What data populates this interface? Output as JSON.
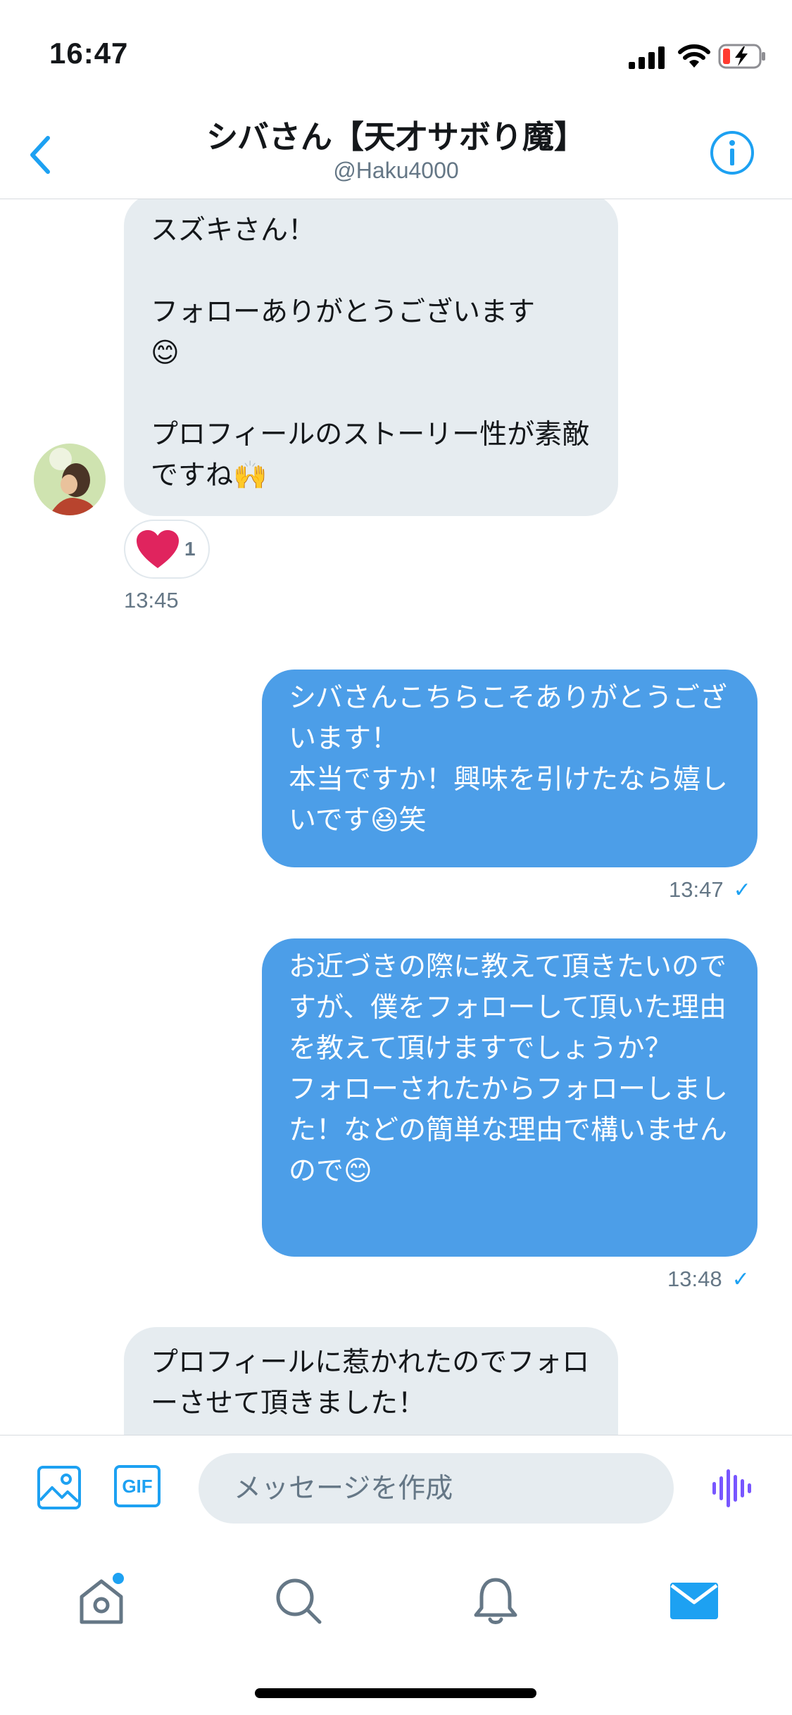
{
  "status_bar": {
    "time": "16:47"
  },
  "header": {
    "title": "シバさん【天才サボり魔】",
    "handle": "@Haku4000"
  },
  "messages": [
    {
      "direction": "incoming",
      "text": "スズキさん！\n\nフォローありがとうございます\n😊\n\nプロフィールのストーリー性が素敵ですね🙌",
      "reaction": {
        "emoji": "heart",
        "count": "1"
      },
      "time": "13:45"
    },
    {
      "direction": "outgoing",
      "text": "シバさんこちらこそありがとうございます！\n本当ですか！興味を引けたなら嬉しいです😆笑",
      "time": "13:47"
    },
    {
      "direction": "outgoing",
      "text": "お近づきの際に教えて頂きたいのですが、僕をフォローして頂いた理由を教えて頂けますでしょうか？\nフォローされたからフォローしました！などの簡単な理由で構いませんので😊",
      "time": "13:48"
    },
    {
      "direction": "incoming",
      "text": "プロフィールに惹かれたのでフォローさせて頂きました！"
    }
  ],
  "composer": {
    "placeholder": "メッセージを作成",
    "gif_label": "GIF"
  },
  "colors": {
    "accent": "#1da1f2",
    "outgoing_bubble": "#4c9ee8",
    "incoming_bubble": "#e6ecf0",
    "voice_icon": "#7856ff",
    "heart": "#e0245e"
  },
  "tabs": [
    {
      "icon": "home-icon",
      "has_notification_dot": true
    },
    {
      "icon": "search-icon"
    },
    {
      "icon": "bell-icon"
    },
    {
      "icon": "mail-icon",
      "active": true
    }
  ]
}
